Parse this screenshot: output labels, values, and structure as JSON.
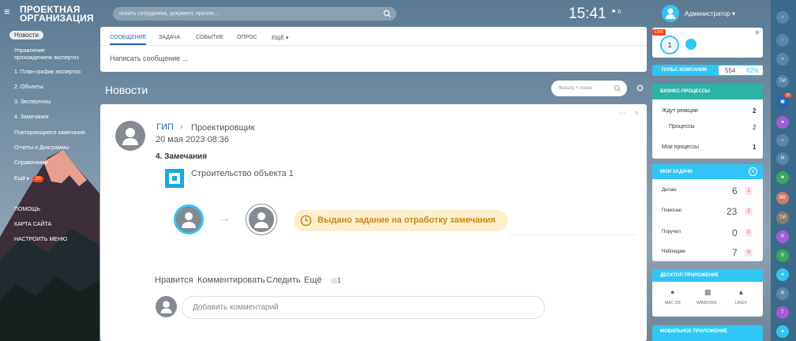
{
  "header": {
    "logo_line1": "ПРОЕКТНАЯ",
    "logo_line2": "ОРГАНИЗАЦИЯ",
    "search_placeholder": "искать сотрудника, документ, прочее...",
    "time": "15:41",
    "notif_count": "0",
    "user_name": "Администратор"
  },
  "sidebar": {
    "items": [
      {
        "label": "Новости"
      },
      {
        "label": "Управление"
      },
      {
        "label": "прохождением экспертиз"
      },
      {
        "label": "1. План-график экспертиз"
      },
      {
        "label": "2. Объекты"
      },
      {
        "label": "3. Экспертизы"
      },
      {
        "label": "4. Замечания"
      },
      {
        "label": "Повторяющиеся замечания"
      },
      {
        "label": "Отчеты и Диаграммы"
      },
      {
        "label": "Справочники"
      },
      {
        "label": "Ещё"
      }
    ],
    "more_badge": "20",
    "bottom": [
      {
        "label": "ПОМОЩЬ"
      },
      {
        "label": "КАРТА САЙТА"
      },
      {
        "label": "НАСТРОИТЬ МЕНЮ"
      }
    ]
  },
  "composer": {
    "tabs": [
      {
        "label": "СООБЩЕНИЕ"
      },
      {
        "label": "ЗАДАЧА"
      },
      {
        "label": "СОБЫТИЕ"
      },
      {
        "label": "ОПРОС"
      },
      {
        "label": "ЕЩЁ"
      }
    ],
    "placeholder": "Написать сообщение ..."
  },
  "feed": {
    "title": "Новости",
    "filter_placeholder": "Фильтр + поиск"
  },
  "post": {
    "author": "ГИП",
    "recipient": "Проектировщик",
    "date": "20 мая 2023 08:36",
    "text": "4. Замечания",
    "project": "Строительство объекта 1",
    "task_status": "Выдано задание на отработку замечания",
    "actions": [
      {
        "label": "Нравится"
      },
      {
        "label": "Комментировать"
      },
      {
        "label": "Следить"
      },
      {
        "label": "Ещё"
      }
    ],
    "views": "1",
    "comment_placeholder": "Добавить комментарий"
  },
  "right": {
    "live_badge": "LIVE",
    "live_count": "1",
    "pulse_label": "ПУЛЬС КОМПАНИИ",
    "pulse_value": "554",
    "pulse_percent": "62%",
    "bp": {
      "title": "БИЗНЕС-ПРОЦЕССЫ",
      "rows": [
        {
          "label": "Ждут реакции",
          "value": "2"
        },
        {
          "label": "Процессы",
          "value": "2"
        },
        {
          "label": "Мои процессы",
          "value": "1"
        }
      ]
    },
    "tasks": {
      "title": "МОИ ЗАДАЧИ",
      "rows": [
        {
          "label": "Делаю",
          "value": "6",
          "badge": "1"
        },
        {
          "label": "Помогаю",
          "value": "23",
          "badge": "2"
        },
        {
          "label": "Поручил",
          "value": "0",
          "badge": "0"
        },
        {
          "label": "Наблюдаю",
          "value": "7",
          "badge": "0"
        }
      ]
    },
    "desktop": {
      "title": "ДЕСКТОП ПРИЛОЖЕНИЕ",
      "os": [
        {
          "label": "MAC OS"
        },
        {
          "label": "WINDOWS"
        },
        {
          "label": "LINUX"
        }
      ]
    },
    "mobile": {
      "title": "МОБИЛЬНОЕ ПРИЛОЖЕНИЕ"
    }
  },
  "rightbar": {
    "icons": [
      {
        "label": "ТИ"
      },
      {
        "label": "R"
      },
      {
        "label": "BR"
      },
      {
        "label": "ТИ"
      },
      {
        "label": "R"
      },
      {
        "label": "R"
      },
      {
        "label": "R"
      },
      {
        "label": "Т"
      }
    ],
    "badge_count": "20"
  },
  "colors": {
    "accent": "#2fc6f6",
    "link": "#2067b0",
    "task_bg": "#fcefcc"
  }
}
